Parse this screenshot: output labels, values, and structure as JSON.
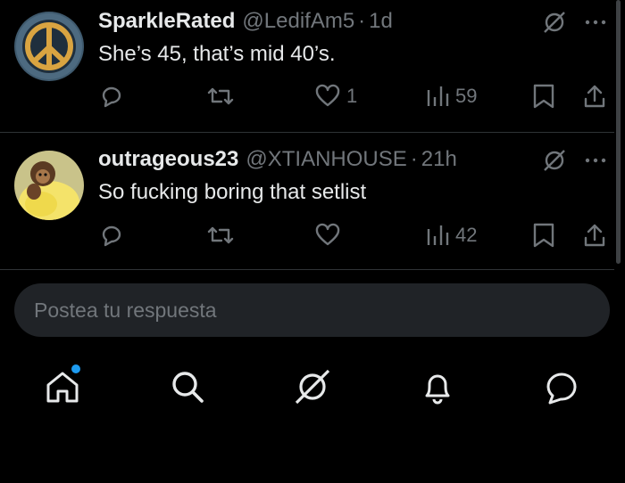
{
  "tweets": [
    {
      "name": "SparkleRated",
      "handle": "@LedifAm5",
      "separator": "·",
      "time": "1d",
      "text": "She’s 45, that’s mid 40’s.",
      "likes": "1",
      "views": "59",
      "avatar": "peace-sign-avatar"
    },
    {
      "name": "outrageous23",
      "handle": "@XTIANHOUSE",
      "separator": "·",
      "time": "21h",
      "text": "So fucking boring that setlist",
      "likes": "",
      "views": "42",
      "avatar": "monkey-avatar"
    }
  ],
  "reply_bar": {
    "placeholder": "Postea tu respuesta"
  },
  "bottom_nav": {
    "items": [
      "home-icon",
      "search-icon",
      "grok-icon",
      "notifications-icon",
      "messages-icon"
    ],
    "home_has_badge": true
  },
  "colors": {
    "background": "#000000",
    "text": "#e7e9ea",
    "muted": "#71767b",
    "accent": "#1d9bf0",
    "input_bg": "#202327"
  }
}
